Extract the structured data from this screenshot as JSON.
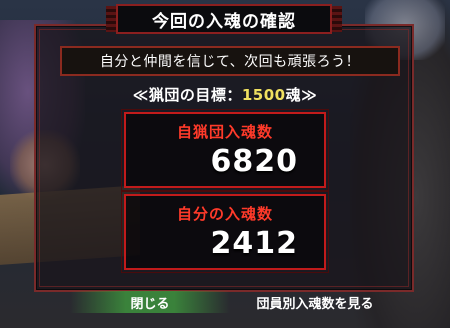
{
  "dialog": {
    "title": "今回の入魂の確認",
    "message": "自分と仲間を信じて、次回も頑張ろう！",
    "goal_prefix": "≪猟団の目標：",
    "goal_value": "1500",
    "goal_suffix": "魂≫"
  },
  "stats": {
    "clan_label": "自猟団入魂数",
    "clan_value": "6820",
    "self_label": "自分の入魂数",
    "self_value": "2412"
  },
  "footer": {
    "close_label": "閉じる",
    "members_label": "団員別入魂数を見る"
  },
  "colors": {
    "accent_red": "#c21b1b",
    "label_red": "#ff3a2a",
    "goal_yellow": "#f0e060",
    "selected_green": "#3c8c3c"
  }
}
